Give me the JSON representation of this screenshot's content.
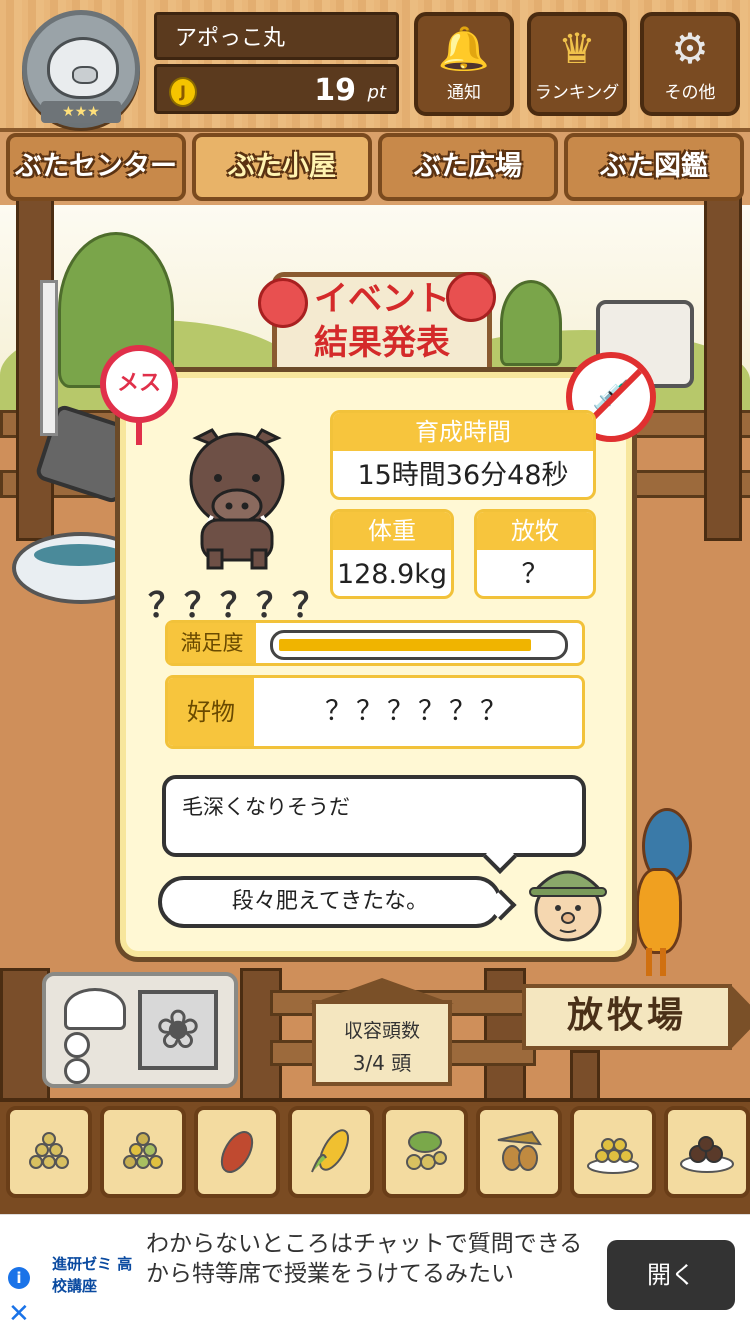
{
  "header": {
    "player_name": "アポっこ丸",
    "points_value": "19",
    "points_unit": "pt",
    "rank_stars": "★★★",
    "buttons": [
      {
        "label": "通知",
        "icon": "bell-icon"
      },
      {
        "label": "ランキング",
        "icon": "crown-icon"
      },
      {
        "label": "その他",
        "icon": "gear-icon"
      }
    ]
  },
  "nav": {
    "tabs": [
      {
        "label": "ぶたセンター",
        "active": false
      },
      {
        "label": "ぶた小屋",
        "active": true
      },
      {
        "label": "ぶた広場",
        "active": false
      },
      {
        "label": "ぶた図鑑",
        "active": false
      }
    ]
  },
  "scene": {
    "event_sign_line1": "イベント",
    "event_sign_line2": "結果発表"
  },
  "pig": {
    "gender_label": "メス",
    "name": "？？？？？",
    "raise_time_label": "育成時間",
    "raise_time_value": "15時間36分48秒",
    "weight_label": "体重",
    "weight_value": "128.9kg",
    "grazing_label": "放牧",
    "grazing_value": "？",
    "satisfaction_label": "満足度",
    "satisfaction_level": 0.9,
    "favorite_label": "好物",
    "favorite_value": "？？？？？？",
    "comment": "毛深くなりそうだ",
    "farmer_speech": "段々肥えてきたな。"
  },
  "bottom": {
    "capacity_label": "収容頭数",
    "capacity_value": "3/4 頭",
    "pasture_sign": "放牧場"
  },
  "feeds": [
    {
      "name": "grain-pile-icon"
    },
    {
      "name": "mixed-grain-icon"
    },
    {
      "name": "sweet-potato-icon"
    },
    {
      "name": "corn-icon"
    },
    {
      "name": "leafy-nuts-icon"
    },
    {
      "name": "acorn-icon"
    },
    {
      "name": "grain-plate-icon"
    },
    {
      "name": "truffle-plate-icon"
    }
  ],
  "ad": {
    "brand": "進研ゼミ 高校講座",
    "text": "わからないところはチャットで質問できるから特等席で授業をうけてるみたい",
    "open_button": "開く"
  },
  "colors": {
    "accent_yellow": "#f7c53d",
    "wood_dark": "#7a4b22",
    "female_red": "#e0304a"
  }
}
